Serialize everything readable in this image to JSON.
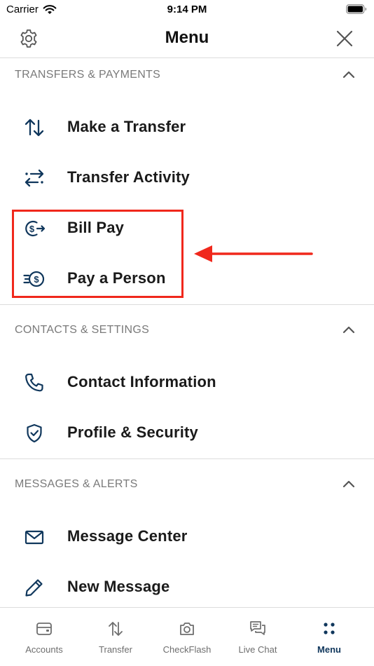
{
  "status_bar": {
    "carrier": "Carrier",
    "time": "9:14 PM"
  },
  "header": {
    "title": "Menu",
    "left_icon": "gear-icon",
    "right_icon": "close-icon"
  },
  "sections": [
    {
      "title": "TRANSFERS & PAYMENTS",
      "items": [
        {
          "label": "Make a Transfer",
          "icon": "transfer-arrows-icon"
        },
        {
          "label": "Transfer Activity",
          "icon": "transfer-activity-icon"
        },
        {
          "label": "Bill Pay",
          "icon": "bill-pay-icon"
        },
        {
          "label": "Pay a Person",
          "icon": "pay-person-icon"
        }
      ]
    },
    {
      "title": "CONTACTS & SETTINGS",
      "items": [
        {
          "label": "Contact Information",
          "icon": "phone-icon"
        },
        {
          "label": "Profile & Security",
          "icon": "shield-check-icon"
        }
      ]
    },
    {
      "title": "MESSAGES & ALERTS",
      "items": [
        {
          "label": "Message Center",
          "icon": "envelope-icon"
        },
        {
          "label": "New Message",
          "icon": "pencil-icon"
        }
      ]
    }
  ],
  "tabbar": {
    "active": "Menu",
    "tabs": [
      {
        "label": "Accounts",
        "icon": "wallet-icon"
      },
      {
        "label": "Transfer",
        "icon": "transfer-arrows-icon"
      },
      {
        "label": "CheckFlash",
        "icon": "camera-icon"
      },
      {
        "label": "Live Chat",
        "icon": "chat-icon"
      },
      {
        "label": "Menu",
        "icon": "dots-grid-icon"
      }
    ]
  },
  "colors": {
    "icon": "#10375c",
    "section_title": "#7a7a7a",
    "highlight": "#f0281c",
    "active_tab": "#10375c",
    "inactive_tab": "#6e6e6e"
  }
}
